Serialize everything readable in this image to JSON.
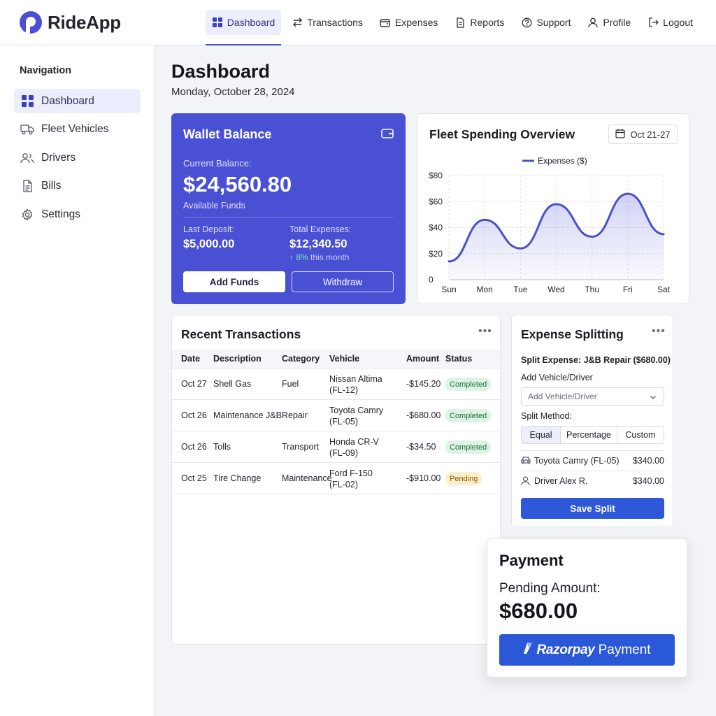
{
  "app": {
    "name": "RideApp"
  },
  "topnav": [
    {
      "label": "Dashboard",
      "icon": "grid-icon",
      "active": true
    },
    {
      "label": "Transactions",
      "icon": "swap-arrows-icon"
    },
    {
      "label": "Expenses",
      "icon": "wallet-icon"
    },
    {
      "label": "Reports",
      "icon": "document-icon"
    },
    {
      "label": "Support",
      "icon": "question-circle-icon"
    },
    {
      "label": "Profile",
      "icon": "user-icon"
    },
    {
      "label": "Logout",
      "icon": "logout-icon"
    }
  ],
  "sidebar": {
    "title": "Navigation",
    "items": [
      {
        "label": "Dashboard",
        "icon": "grid-icon",
        "active": true
      },
      {
        "label": "Fleet Vehicles",
        "icon": "truck-icon"
      },
      {
        "label": "Drivers",
        "icon": "users-icon"
      },
      {
        "label": "Bills",
        "icon": "bill-icon"
      },
      {
        "label": "Settings",
        "icon": "gear-icon"
      }
    ]
  },
  "page": {
    "title": "Dashboard",
    "date": "Monday, October 28, 2024"
  },
  "wallet": {
    "title": "Wallet Balance",
    "current_label": "Current Balance:",
    "balance": "$24,560.80",
    "available": "Available Funds",
    "last_deposit_label": "Last Deposit:",
    "last_deposit": "$5,000.00",
    "total_expenses_label": "Total Expenses:",
    "total_expenses": "$12,340.50",
    "trend_arrow": "↑",
    "trend_pct": "8%",
    "trend_text": "this month",
    "add_funds": "Add Funds",
    "withdraw": "Withdraw",
    "colors": {
      "card": "#4a50d4"
    }
  },
  "chart_card": {
    "title": "Fleet Spending Overview",
    "date_range": "Oct 21-27"
  },
  "chart_data": {
    "type": "line",
    "categories": [
      "Sun",
      "Mon",
      "Tue",
      "Wed",
      "Thu",
      "Fri",
      "Sat"
    ],
    "series": [
      {
        "name": "Expenses ($)",
        "values": [
          14,
          46,
          24,
          58,
          33,
          66,
          35
        ],
        "color": "#4a50c8"
      }
    ],
    "y_ticks": [
      "0",
      "$20",
      "$40",
      "$60",
      "$80"
    ],
    "ylim": [
      0,
      80
    ],
    "grid": true,
    "legend": "top-center"
  },
  "transactions": {
    "title": "Recent Transactions",
    "columns": [
      "Date",
      "Description",
      "Category",
      "Vehicle",
      "Amount",
      "Status"
    ],
    "rows": [
      {
        "date": "Oct 27",
        "description": "Shell Gas",
        "category": "Fuel",
        "vehicle_name": "Nissan Altima",
        "vehicle_id": "(FL-12)",
        "amount": "-$145.20",
        "status": "Completed"
      },
      {
        "date": "Oct 26",
        "description": "Maintenance J&B",
        "category": "Repair",
        "vehicle_name": "Toyota Camry",
        "vehicle_id": "(FL-05)",
        "amount": "-$680.00",
        "status": "Completed"
      },
      {
        "date": "Oct 26",
        "description": "Tolls",
        "category": "Transport",
        "vehicle_name": "Honda CR-V",
        "vehicle_id": "(FL-09)",
        "amount": "-$34.50",
        "status": "Completed"
      },
      {
        "date": "Oct 25",
        "description": "Tire Change",
        "category": "Maintenance",
        "vehicle_name": "Ford F-150",
        "vehicle_id": "(FL-02)",
        "amount": "-$910.00",
        "status": "Pending"
      }
    ]
  },
  "splitting": {
    "title": "Expense Splitting",
    "expense": "Split Expense: J&B Repair ($680.00)",
    "add_label": "Add Vehicle/Driver",
    "add_placeholder": "Add Vehicle/Driver",
    "method_label": "Split Method:",
    "methods": [
      "Equal",
      "Percentage",
      "Custom"
    ],
    "selected_method": "Equal",
    "allocations": [
      {
        "name": "Toyota Camry (FL-05)",
        "amount": "$340.00",
        "icon": "car-icon"
      },
      {
        "name": "Driver Alex R.",
        "amount": "$340.00",
        "icon": "user-icon"
      }
    ],
    "save": "Save Split"
  },
  "payment": {
    "title": "Payment",
    "label": "Pending Amount:",
    "amount": "$680.00",
    "brand": "Razorpay",
    "button_text": "Payment"
  }
}
